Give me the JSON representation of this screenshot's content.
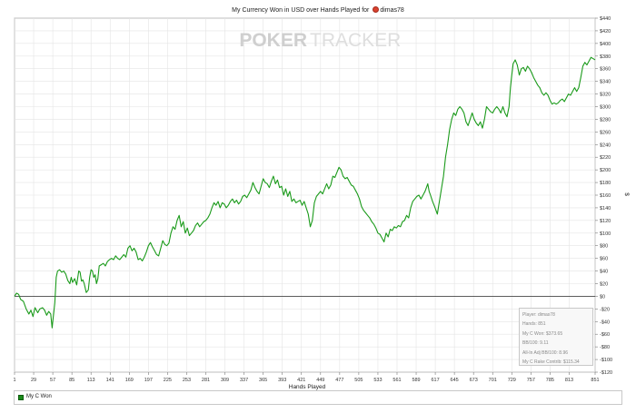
{
  "header": {
    "title_prefix": "My Currency Won in USD over Hands Played for",
    "player_name": "dimas78",
    "flag_icon": "flag-icon"
  },
  "watermark": {
    "part1": "POKER",
    "part2": "TRACKER"
  },
  "stats": [
    "Player: dimas78",
    "Hands: 851",
    "My C Won: $373.65",
    "BB/100: 9.11",
    "All-In Adj BB/100: 8.96",
    "My C Rake Contrib: $115.34"
  ],
  "legend": {
    "label": "My C Won"
  },
  "colors": {
    "series": "#1a9a1a",
    "grid": "#e4e4e4",
    "zero_line": "#444444"
  },
  "chart_data": {
    "type": "line",
    "title": "My Currency Won in USD over Hands Played for dimas78",
    "xlabel": "Hands Played",
    "ylabel": "$",
    "xlim": [
      1,
      851
    ],
    "ylim": [
      -120,
      440
    ],
    "grid": true,
    "legend_position": "bottom-left",
    "x_ticks": [
      1,
      29,
      57,
      85,
      113,
      141,
      169,
      197,
      225,
      253,
      281,
      309,
      337,
      365,
      393,
      421,
      449,
      477,
      505,
      533,
      561,
      589,
      617,
      645,
      673,
      701,
      729,
      757,
      785,
      813,
      851
    ],
    "y_ticks": [
      -120,
      -100,
      -80,
      -60,
      -40,
      -20,
      0,
      20,
      40,
      60,
      80,
      100,
      120,
      140,
      160,
      180,
      200,
      220,
      240,
      260,
      280,
      300,
      320,
      340,
      360,
      380,
      400,
      420,
      440
    ],
    "y_tick_labels": [
      "-$120",
      "-$100",
      "-$80",
      "-$60",
      "-$40",
      "-$20",
      "$0",
      "$20",
      "$40",
      "$60",
      "$80",
      "$100",
      "$120",
      "$140",
      "$160",
      "$180",
      "$200",
      "$220",
      "$240",
      "$260",
      "$280",
      "$300",
      "$320",
      "$340",
      "$360",
      "$380",
      "$400",
      "$420",
      "$440"
    ],
    "series": [
      {
        "name": "My C Won",
        "points": [
          [
            1,
            0
          ],
          [
            4,
            5
          ],
          [
            7,
            3
          ],
          [
            10,
            -5
          ],
          [
            14,
            -8
          ],
          [
            18,
            -20
          ],
          [
            22,
            -28
          ],
          [
            25,
            -22
          ],
          [
            28,
            -32
          ],
          [
            31,
            -18
          ],
          [
            35,
            -26
          ],
          [
            38,
            -20
          ],
          [
            42,
            -18
          ],
          [
            45,
            -22
          ],
          [
            48,
            -30
          ],
          [
            51,
            -24
          ],
          [
            54,
            -28
          ],
          [
            56,
            -50
          ],
          [
            58,
            -30
          ],
          [
            60,
            -10
          ],
          [
            62,
            30
          ],
          [
            64,
            40
          ],
          [
            67,
            42
          ],
          [
            70,
            38
          ],
          [
            73,
            40
          ],
          [
            76,
            35
          ],
          [
            79,
            25
          ],
          [
            82,
            20
          ],
          [
            84,
            30
          ],
          [
            86,
            22
          ],
          [
            89,
            28
          ],
          [
            92,
            18
          ],
          [
            95,
            40
          ],
          [
            97,
            38
          ],
          [
            99,
            24
          ],
          [
            101,
            26
          ],
          [
            103,
            20
          ],
          [
            106,
            6
          ],
          [
            109,
            10
          ],
          [
            111,
            30
          ],
          [
            113,
            42
          ],
          [
            115,
            40
          ],
          [
            117,
            30
          ],
          [
            119,
            34
          ],
          [
            121,
            20
          ],
          [
            123,
            28
          ],
          [
            125,
            48
          ],
          [
            128,
            50
          ],
          [
            131,
            52
          ],
          [
            134,
            48
          ],
          [
            137,
            55
          ],
          [
            140,
            58
          ],
          [
            143,
            60
          ],
          [
            146,
            58
          ],
          [
            149,
            64
          ],
          [
            152,
            60
          ],
          [
            155,
            58
          ],
          [
            158,
            62
          ],
          [
            161,
            66
          ],
          [
            164,
            62
          ],
          [
            167,
            76
          ],
          [
            170,
            80
          ],
          [
            173,
            72
          ],
          [
            176,
            76
          ],
          [
            179,
            70
          ],
          [
            182,
            58
          ],
          [
            185,
            60
          ],
          [
            188,
            56
          ],
          [
            191,
            62
          ],
          [
            194,
            70
          ],
          [
            197,
            80
          ],
          [
            200,
            85
          ],
          [
            203,
            78
          ],
          [
            206,
            72
          ],
          [
            209,
            66
          ],
          [
            212,
            64
          ],
          [
            215,
            76
          ],
          [
            218,
            88
          ],
          [
            221,
            82
          ],
          [
            224,
            80
          ],
          [
            227,
            84
          ],
          [
            230,
            100
          ],
          [
            233,
            110
          ],
          [
            236,
            106
          ],
          [
            239,
            120
          ],
          [
            242,
            128
          ],
          [
            245,
            110
          ],
          [
            248,
            118
          ],
          [
            251,
            100
          ],
          [
            254,
            108
          ],
          [
            257,
            96
          ],
          [
            260,
            100
          ],
          [
            263,
            104
          ],
          [
            266,
            112
          ],
          [
            269,
            116
          ],
          [
            272,
            110
          ],
          [
            275,
            114
          ],
          [
            278,
            118
          ],
          [
            281,
            120
          ],
          [
            284,
            124
          ],
          [
            287,
            130
          ],
          [
            290,
            140
          ],
          [
            293,
            148
          ],
          [
            296,
            144
          ],
          [
            299,
            150
          ],
          [
            302,
            140
          ],
          [
            305,
            148
          ],
          [
            308,
            146
          ],
          [
            311,
            140
          ],
          [
            314,
            144
          ],
          [
            317,
            150
          ],
          [
            320,
            154
          ],
          [
            323,
            148
          ],
          [
            326,
            152
          ],
          [
            329,
            146
          ],
          [
            332,
            150
          ],
          [
            335,
            158
          ],
          [
            338,
            160
          ],
          [
            341,
            156
          ],
          [
            344,
            162
          ],
          [
            347,
            168
          ],
          [
            350,
            180
          ],
          [
            353,
            172
          ],
          [
            356,
            166
          ],
          [
            359,
            162
          ],
          [
            362,
            174
          ],
          [
            365,
            186
          ],
          [
            368,
            180
          ],
          [
            371,
            178
          ],
          [
            374,
            172
          ],
          [
            377,
            182
          ],
          [
            380,
            190
          ],
          [
            383,
            178
          ],
          [
            386,
            184
          ],
          [
            389,
            172
          ],
          [
            392,
            174
          ],
          [
            395,
            160
          ],
          [
            398,
            170
          ],
          [
            401,
            158
          ],
          [
            404,
            166
          ],
          [
            407,
            150
          ],
          [
            410,
            154
          ],
          [
            413,
            148
          ],
          [
            416,
            150
          ],
          [
            419,
            152
          ],
          [
            422,
            144
          ],
          [
            425,
            150
          ],
          [
            428,
            140
          ],
          [
            431,
            130
          ],
          [
            434,
            110
          ],
          [
            437,
            120
          ],
          [
            440,
            148
          ],
          [
            443,
            158
          ],
          [
            446,
            162
          ],
          [
            449,
            166
          ],
          [
            452,
            162
          ],
          [
            455,
            170
          ],
          [
            458,
            178
          ],
          [
            461,
            170
          ],
          [
            464,
            176
          ],
          [
            467,
            190
          ],
          [
            470,
            188
          ],
          [
            473,
            196
          ],
          [
            476,
            204
          ],
          [
            479,
            200
          ],
          [
            482,
            190
          ],
          [
            485,
            186
          ],
          [
            488,
            188
          ],
          [
            491,
            182
          ],
          [
            494,
            176
          ],
          [
            497,
            174
          ],
          [
            500,
            168
          ],
          [
            503,
            162
          ],
          [
            506,
            154
          ],
          [
            509,
            142
          ],
          [
            512,
            136
          ],
          [
            515,
            132
          ],
          [
            518,
            128
          ],
          [
            521,
            124
          ],
          [
            524,
            118
          ],
          [
            527,
            114
          ],
          [
            530,
            108
          ],
          [
            533,
            100
          ],
          [
            536,
            98
          ],
          [
            539,
            92
          ],
          [
            542,
            86
          ],
          [
            545,
            100
          ],
          [
            548,
            94
          ],
          [
            551,
            106
          ],
          [
            554,
            104
          ],
          [
            557,
            110
          ],
          [
            560,
            108
          ],
          [
            563,
            112
          ],
          [
            566,
            110
          ],
          [
            569,
            118
          ],
          [
            572,
            120
          ],
          [
            575,
            128
          ],
          [
            578,
            124
          ],
          [
            581,
            140
          ],
          [
            584,
            150
          ],
          [
            587,
            154
          ],
          [
            590,
            158
          ],
          [
            593,
            160
          ],
          [
            596,
            154
          ],
          [
            599,
            160
          ],
          [
            602,
            166
          ],
          [
            604,
            172
          ],
          [
            606,
            178
          ],
          [
            608,
            166
          ],
          [
            610,
            160
          ],
          [
            613,
            150
          ],
          [
            616,
            142
          ],
          [
            618,
            136
          ],
          [
            620,
            130
          ],
          [
            623,
            150
          ],
          [
            626,
            170
          ],
          [
            629,
            190
          ],
          [
            632,
            220
          ],
          [
            635,
            240
          ],
          [
            638,
            264
          ],
          [
            641,
            280
          ],
          [
            644,
            290
          ],
          [
            647,
            286
          ],
          [
            650,
            296
          ],
          [
            653,
            300
          ],
          [
            656,
            296
          ],
          [
            659,
            290
          ],
          [
            662,
            276
          ],
          [
            665,
            270
          ],
          [
            668,
            280
          ],
          [
            671,
            290
          ],
          [
            674,
            280
          ],
          [
            677,
            274
          ],
          [
            680,
            270
          ],
          [
            683,
            276
          ],
          [
            686,
            266
          ],
          [
            689,
            280
          ],
          [
            692,
            300
          ],
          [
            695,
            296
          ],
          [
            698,
            292
          ],
          [
            701,
            290
          ],
          [
            704,
            296
          ],
          [
            707,
            300
          ],
          [
            710,
            296
          ],
          [
            713,
            290
          ],
          [
            716,
            300
          ],
          [
            719,
            290
          ],
          [
            722,
            284
          ],
          [
            725,
            300
          ],
          [
            727,
            330
          ],
          [
            729,
            350
          ],
          [
            731,
            368
          ],
          [
            734,
            374
          ],
          [
            737,
            366
          ],
          [
            740,
            350
          ],
          [
            743,
            360
          ],
          [
            746,
            362
          ],
          [
            749,
            356
          ],
          [
            752,
            364
          ],
          [
            755,
            360
          ],
          [
            758,
            354
          ],
          [
            761,
            346
          ],
          [
            764,
            340
          ],
          [
            767,
            334
          ],
          [
            770,
            330
          ],
          [
            773,
            322
          ],
          [
            776,
            318
          ],
          [
            779,
            322
          ],
          [
            782,
            318
          ],
          [
            785,
            310
          ],
          [
            788,
            304
          ],
          [
            791,
            306
          ],
          [
            794,
            304
          ],
          [
            797,
            306
          ],
          [
            800,
            310
          ],
          [
            803,
            312
          ],
          [
            806,
            308
          ],
          [
            809,
            314
          ],
          [
            812,
            320
          ],
          [
            815,
            318
          ],
          [
            818,
            324
          ],
          [
            821,
            330
          ],
          [
            824,
            324
          ],
          [
            827,
            330
          ],
          [
            830,
            346
          ],
          [
            833,
            364
          ],
          [
            836,
            370
          ],
          [
            839,
            366
          ],
          [
            842,
            372
          ],
          [
            845,
            378
          ],
          [
            848,
            376
          ],
          [
            851,
            374
          ]
        ]
      }
    ]
  },
  "axis_labels": {
    "x": "Hands Played",
    "y": "$"
  }
}
